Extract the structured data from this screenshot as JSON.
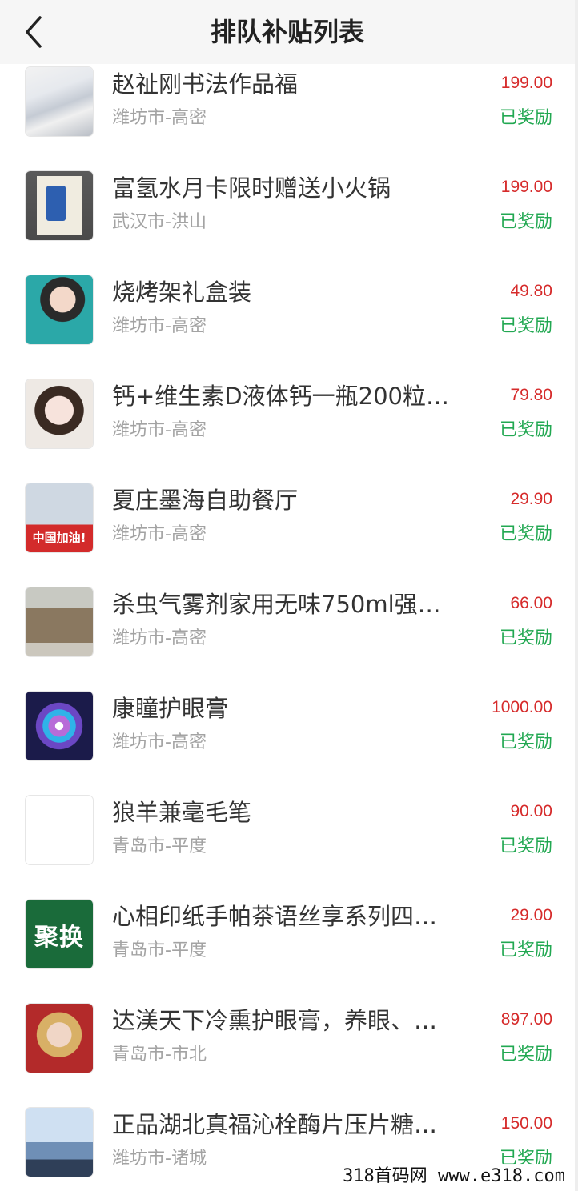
{
  "header": {
    "title": "排队补贴列表",
    "back_icon": "chevron-left-icon"
  },
  "items": [
    {
      "title": "赵祉刚书法作品福",
      "city": "潍坊市-高密",
      "price": "199.00",
      "status": "已奖励",
      "thumb": "ink-painting"
    },
    {
      "title": "富氢水月卡限时赠送小火锅",
      "city": "武汉市-洪山",
      "price": "199.00",
      "status": "已奖励",
      "thumb": "book-cover"
    },
    {
      "title": "烧烤架礼盒装",
      "city": "潍坊市-高密",
      "price": "49.80",
      "status": "已奖励",
      "thumb": "avatar-woman"
    },
    {
      "title": "钙+维生素D液体钙一瓶200粒…",
      "city": "潍坊市-高密",
      "price": "79.80",
      "status": "已奖励",
      "thumb": "avatar-girl"
    },
    {
      "title": "夏庄墨海自助餐厅",
      "city": "潍坊市-高密",
      "price": "29.90",
      "status": "已奖励",
      "thumb": "avatar-boy",
      "thumb_label": "中国加油!"
    },
    {
      "title": "杀虫气雾剂家用无味750ml强…",
      "city": "潍坊市-高密",
      "price": "66.00",
      "status": "已奖励",
      "thumb": "building-photo"
    },
    {
      "title": "康瞳护眼膏",
      "city": "潍坊市-高密",
      "price": "1000.00",
      "status": "已奖励",
      "thumb": "mandala"
    },
    {
      "title": "狼羊兼毫毛笔",
      "city": "青岛市-平度",
      "price": "90.00",
      "status": "已奖励",
      "thumb": "blank"
    },
    {
      "title": "心相印纸手帕茶语丝享系列四…",
      "city": "青岛市-平度",
      "price": "29.00",
      "status": "已奖励",
      "thumb": "green-logo",
      "thumb_label": "聚换"
    },
    {
      "title": "达渼天下冷熏护眼膏，养眼、…",
      "city": "青岛市-市北",
      "price": "897.00",
      "status": "已奖励",
      "thumb": "avatar-woman-red"
    },
    {
      "title": "正品湖北真福沁栓酶片压片糖…",
      "city": "潍坊市-诸城",
      "price": "150.00",
      "status": "已奖励",
      "thumb": "sea-photo"
    }
  ],
  "watermark": "318首码网  www.e318.com",
  "colors": {
    "price": "#d62b2b",
    "status": "#22a852",
    "city": "#a3a3a3",
    "title": "#333333",
    "navbar": "#f6f6f6"
  }
}
